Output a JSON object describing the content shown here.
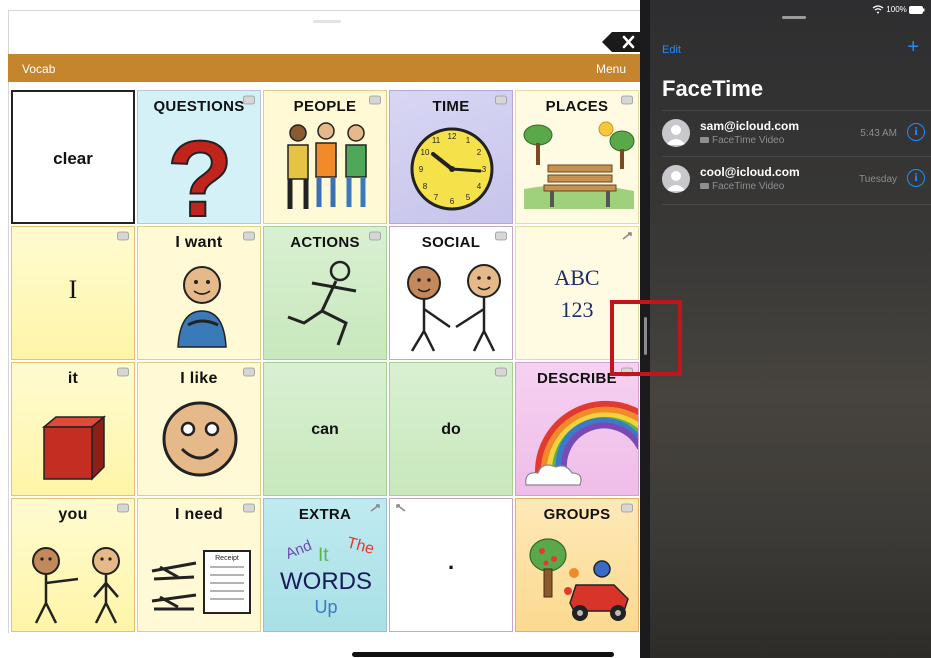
{
  "aac": {
    "bar_label": "Vocab",
    "menu_label": "Menu",
    "cells": {
      "clear": "clear",
      "questions": "QUESTIONS",
      "people": "PEOPLE",
      "time": "TIME",
      "places": "PLACES",
      "i": "I",
      "i_want": "I want",
      "actions": "ACTIONS",
      "social": "SOCIAL",
      "abc": "ABC",
      "num": "123",
      "it": "it",
      "i_like": "I like",
      "can": "can",
      "do": "do",
      "describe": "DESCRIBE",
      "you": "you",
      "i_need": "I need",
      "extra": "EXTRA",
      "period": ".",
      "groups": "GROUPS",
      "extra_words": {
        "and": "And",
        "it": "It",
        "the": "The",
        "words": "WORDS",
        "up": "Up"
      },
      "receipt": "Receipt"
    }
  },
  "facetime": {
    "status": "100%",
    "edit": "Edit",
    "add": "+",
    "title": "FaceTime",
    "calls": [
      {
        "name": "sam@icloud.com",
        "type": "FaceTime Video",
        "time": "5:43 AM"
      },
      {
        "name": "cool@icloud.com",
        "type": "FaceTime Video",
        "time": "Tuesday"
      }
    ]
  },
  "colors": {
    "vocab_bar": "#c5852c",
    "highlight": "#c0161a",
    "ios_blue": "#1f8cff"
  }
}
